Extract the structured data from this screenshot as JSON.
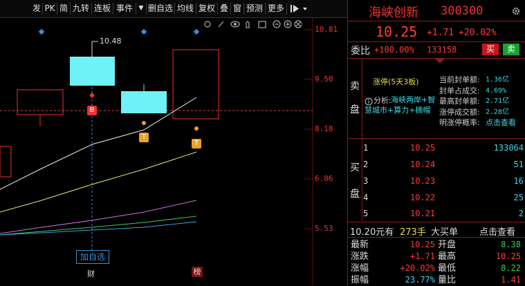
{
  "toolbar": {
    "items": [
      "发",
      "PK",
      "简",
      "九转",
      "连板",
      "事件",
      "▼",
      "删自选",
      "均线",
      "复权",
      "叠",
      "窗",
      "预测",
      "更多"
    ],
    "icon_names": [
      "sidebar-toggle-icon",
      "dropdown-icon"
    ]
  },
  "chart": {
    "price_labels": [
      "10.81",
      "9.50",
      "8.18",
      "6.86",
      "5.53"
    ],
    "high_marker": "10.48",
    "badges": {
      "b": "B",
      "t1": "T",
      "t2": "T"
    },
    "add_watchlist": "加自选",
    "bottom_markers": [
      "财",
      "榜"
    ],
    "toolbar_icons": [
      "settings-icon",
      "pencil-icon",
      "eye-icon",
      "hand-icon",
      "print-icon",
      "zoom-out-icon",
      "zoom-in-icon",
      "close-icon"
    ]
  },
  "header": {
    "name": "海峡创新",
    "code": "300300",
    "price": "10.25",
    "change": "+1.71",
    "change_pct": "+20.02%"
  },
  "weibi": {
    "label": "委比",
    "pct": "+100.00%",
    "vol": "133158",
    "buy_btn": "买",
    "sell_btn": "卖"
  },
  "sell_section": {
    "label_top": "卖",
    "label_bottom": "盘",
    "limit_title": "涨停(5天3板)",
    "analysis_prefix": "分析:",
    "analysis_text": "海峡两岸+智慧城市+算力+摘帽",
    "stats": [
      {
        "label": "当前封单额:",
        "value": "1.36亿"
      },
      {
        "label": "封单占成交:",
        "value": "4.69%"
      },
      {
        "label": "最高封单额:",
        "value": "2.71亿"
      },
      {
        "label": "涨停成交额:",
        "value": "2.28亿"
      },
      {
        "label": "明涨停概率:",
        "value": "点击查看"
      }
    ]
  },
  "buy_section": {
    "label_top": "买",
    "label_bottom": "盘",
    "rows": [
      {
        "level": "1",
        "price": "10.25",
        "vol": "133064"
      },
      {
        "level": "2",
        "price": "10.24",
        "vol": "51"
      },
      {
        "level": "3",
        "price": "10.23",
        "vol": "16"
      },
      {
        "level": "4",
        "price": "10.22",
        "vol": "25"
      },
      {
        "level": "5",
        "price": "10.21",
        "vol": "2"
      }
    ]
  },
  "big_order": {
    "amount": "10.20元有",
    "hands": "273手",
    "label": "大买单",
    "link": "点击查看"
  },
  "quotes": [
    {
      "l1": "最新",
      "v1": "10.25",
      "l2": "开盘",
      "v2": "8.38"
    },
    {
      "l1": "涨跌",
      "v1": "+1.71",
      "l2": "最高",
      "v2": "10.25"
    },
    {
      "l1": "涨幅",
      "v1": "+20.02%",
      "l2": "最低",
      "v2": "8.22"
    },
    {
      "l1": "振幅",
      "v1": "23.77%",
      "l2": "量比",
      "v2": "1.41"
    }
  ]
}
